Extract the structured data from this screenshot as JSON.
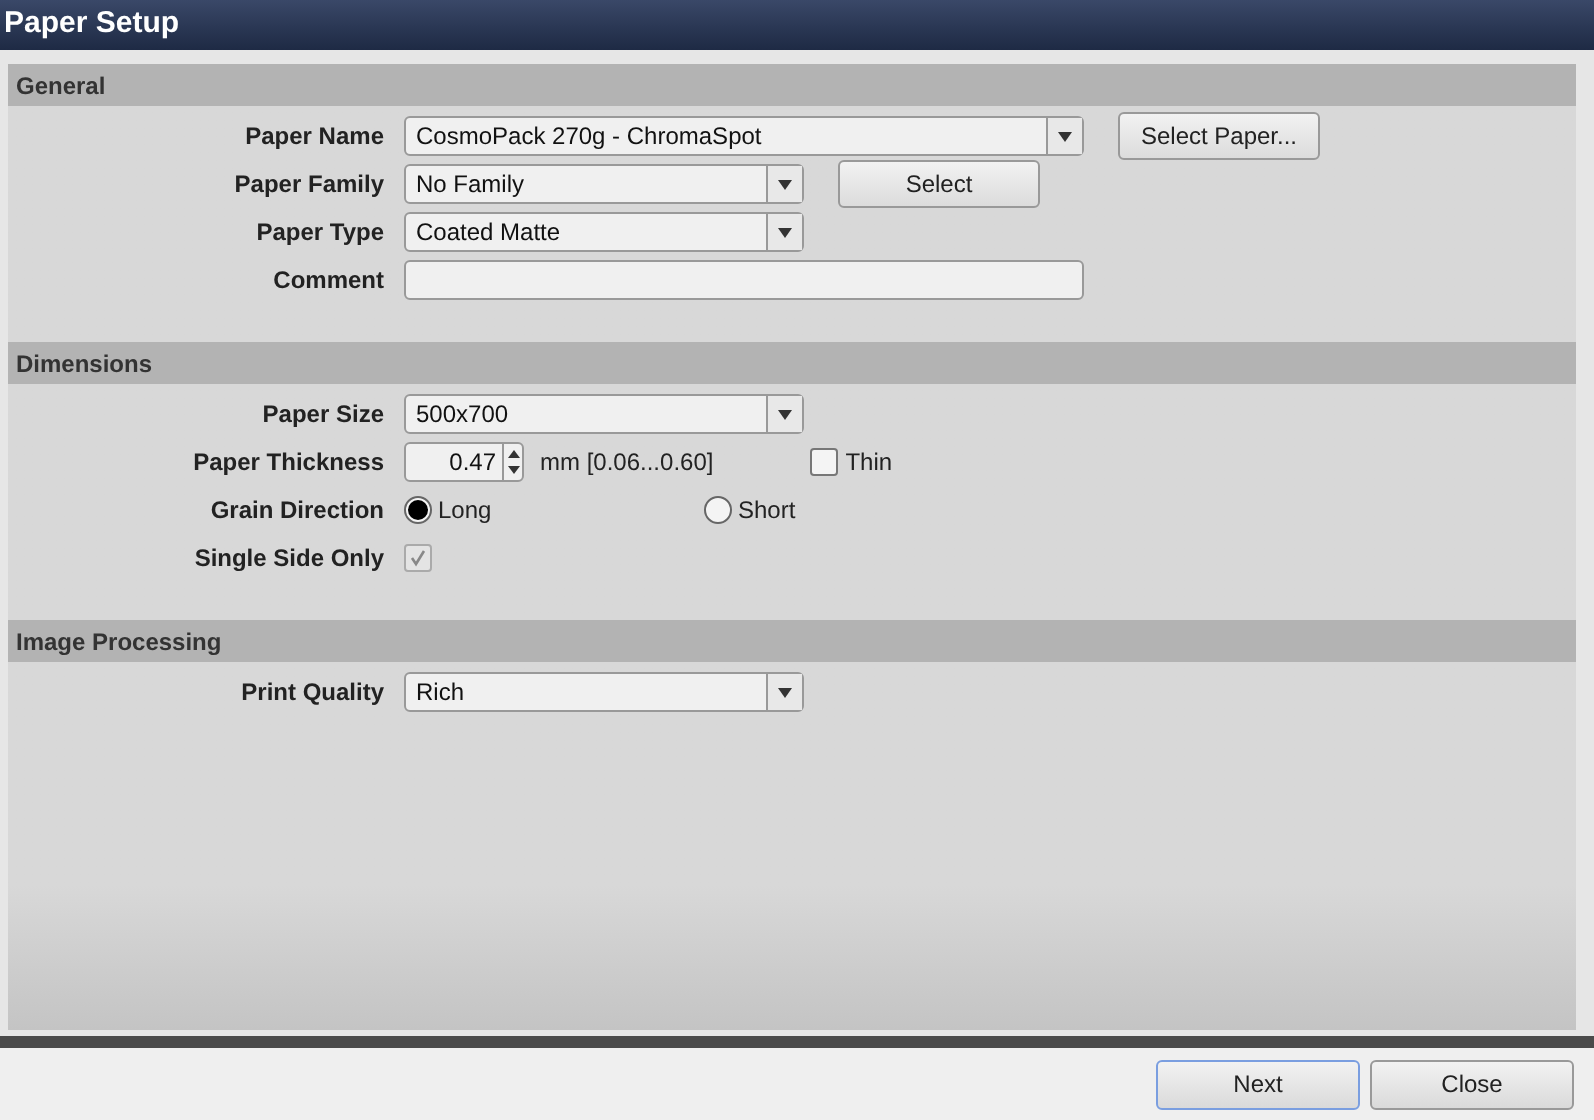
{
  "window": {
    "title": "Paper Setup"
  },
  "sections": [
    {
      "title": "General",
      "rows": [
        {
          "kind": "combo",
          "label": "Paper Name",
          "value": "CosmoPack 270g - ChromaSpot",
          "button": "Select Paper..."
        },
        {
          "kind": "combo",
          "label": "Paper Family",
          "value": "No Family",
          "button": "Select"
        },
        {
          "kind": "combo",
          "label": "Paper Type",
          "value": "Coated Matte"
        },
        {
          "kind": "field",
          "label": "Comment"
        }
      ]
    },
    {
      "title": "Dimensions",
      "rows": [
        {
          "kind": "combo",
          "label": "Paper Size",
          "value": "500x700"
        },
        {
          "kind": "spinner",
          "label": "Paper Thickness",
          "value": "0.47",
          "unit": "mm [0.06...0.60]",
          "check": {
            "label": "Thin",
            "checked": false
          }
        },
        {
          "kind": "radio",
          "label": "Grain Direction",
          "options": [
            {
              "label": "Long",
              "selected": true
            },
            {
              "label": "Short",
              "selected": false
            }
          ]
        },
        {
          "kind": "checkbox",
          "label": "Single Side Only",
          "checked": true,
          "disabled": true
        }
      ]
    },
    {
      "title": "Image Processing",
      "rows": [
        {
          "kind": "combo",
          "label": "Print Quality",
          "value": "Rich"
        }
      ]
    }
  ],
  "footer": [
    {
      "label": "Next",
      "focused": true
    },
    {
      "label": "Close",
      "focused": false
    }
  ]
}
